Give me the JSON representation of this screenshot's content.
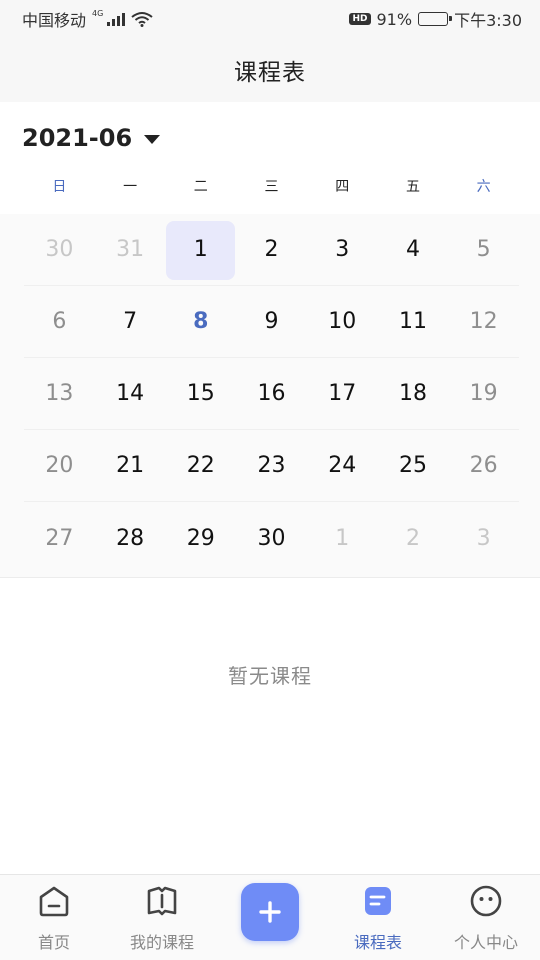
{
  "status_bar": {
    "carrier": "中国移动",
    "network": "4G",
    "hd": "HD",
    "battery": "91%",
    "battery_level": 0.91,
    "time": "下午3:30"
  },
  "header": {
    "title": "课程表"
  },
  "calendar": {
    "month": "2021-06",
    "weekdays": [
      "日",
      "一",
      "二",
      "三",
      "四",
      "五",
      "六"
    ],
    "weeks": [
      [
        "30",
        "31",
        "1",
        "2",
        "3",
        "4",
        "5"
      ],
      [
        "6",
        "7",
        "8",
        "9",
        "10",
        "11",
        "12"
      ],
      [
        "13",
        "14",
        "15",
        "16",
        "17",
        "18",
        "19"
      ],
      [
        "20",
        "21",
        "22",
        "23",
        "24",
        "25",
        "26"
      ],
      [
        "27",
        "28",
        "29",
        "30",
        "1",
        "2",
        "3"
      ]
    ],
    "selected_day": "1",
    "today": "8"
  },
  "empty_state": {
    "text": "暂无课程"
  },
  "tab_bar": {
    "home": "首页",
    "my_courses": "我的课程",
    "schedule": "课程表",
    "profile": "个人中心",
    "active": "schedule"
  },
  "colors": {
    "accent": "#4a6bbf",
    "button": "#6f8cf6",
    "selected_bg": "#e8e9fb"
  },
  "icons": {
    "home": "home-icon",
    "my_courses": "book-icon",
    "add": "plus-icon",
    "schedule": "schedule-icon",
    "profile": "face-icon"
  }
}
